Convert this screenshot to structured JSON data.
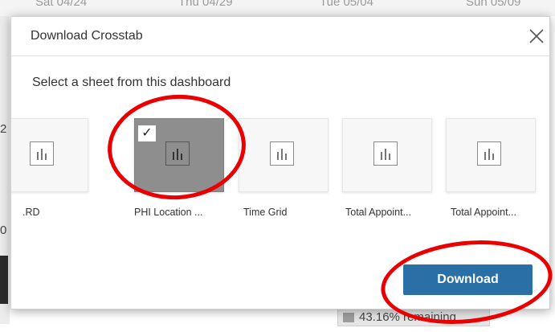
{
  "background": {
    "dates": [
      "Sat 04/24",
      "Thu 04/29",
      "Tue 05/04",
      "Sun 05/09"
    ],
    "left_chars": [
      "2",
      "0"
    ],
    "bottom_bar_text": "43.16% remaining"
  },
  "dialog": {
    "title": "Download Crosstab",
    "close_icon": "close-icon",
    "subtitle": "Select a sheet from this dashboard",
    "sheets": [
      {
        "label": ".RD",
        "selected": false,
        "icon": "bar-chart-icon"
      },
      {
        "label": "PHI Location ...",
        "selected": true,
        "check": "✓",
        "icon": "bar-chart-icon"
      },
      {
        "label": "Time Grid",
        "selected": false,
        "icon": "bar-chart-icon"
      },
      {
        "label": "Total Appoint...",
        "selected": false,
        "icon": "bar-chart-icon"
      },
      {
        "label": "Total Appoint...",
        "selected": false,
        "icon": "bar-chart-icon"
      }
    ],
    "download_label": "Download"
  },
  "colors": {
    "download_button": "#2a6fa6",
    "annotation": "#ea0000",
    "selected_sheet": "#8e8e8e"
  }
}
